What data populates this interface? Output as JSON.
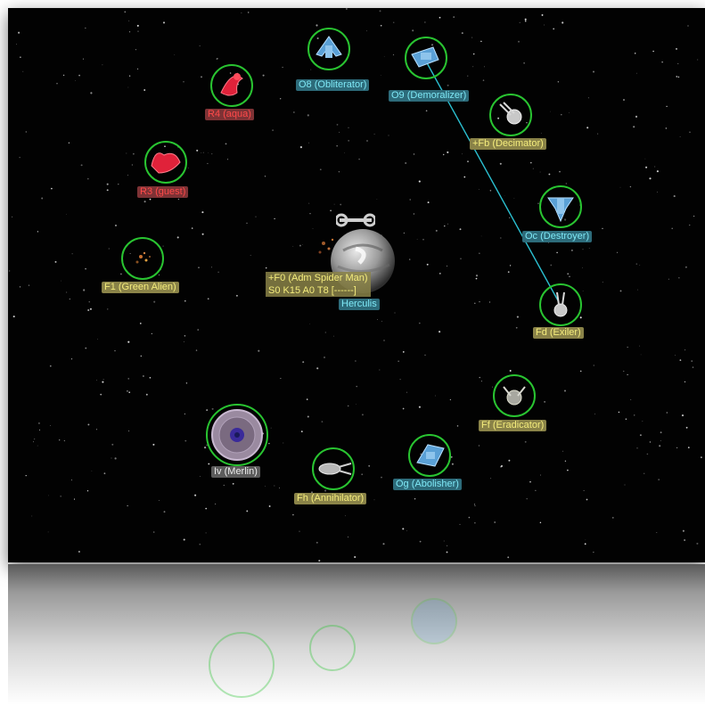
{
  "colors": {
    "ship_ring": "#29c431",
    "tractor_beam": "#2bbfd0",
    "label_yellow_text": "#f4ec7c",
    "label_cyan_text": "#7ee8f6",
    "label_red_text": "#ff4a4a"
  },
  "ships": [
    {
      "id": "O8",
      "label": "O8 (Obliterator)",
      "team": "cyan",
      "icon": "romulan-warbird-icon"
    },
    {
      "id": "O9",
      "label": "O9 (Demoralizer)",
      "team": "cyan",
      "icon": "romulan-warbird-icon"
    },
    {
      "id": "R4",
      "label": "R4 (aqua)",
      "team": "red",
      "icon": "klingon-cruiser-icon"
    },
    {
      "id": "R3",
      "label": "R3 (guest)",
      "team": "red",
      "icon": "klingon-cruiser-icon"
    },
    {
      "id": "Fb",
      "label": "+Fb (Decimator)",
      "team": "yellow",
      "icon": "federation-starship-icon"
    },
    {
      "id": "Oc",
      "label": "Oc (Destroyer)",
      "team": "cyan",
      "icon": "romulan-warbird-icon"
    },
    {
      "id": "F1",
      "label": "F1 (Green Alien)",
      "team": "yellow",
      "icon": "explosion-debris-icon"
    },
    {
      "id": "Fd",
      "label": "Fd (Exiler)",
      "team": "yellow",
      "icon": "federation-starship-icon"
    },
    {
      "id": "Ff",
      "label": "Ff (Eradicator)",
      "team": "yellow",
      "icon": "federation-starship-icon"
    },
    {
      "id": "Iv",
      "label": "Iv (Merlin)",
      "team": "white",
      "icon": "independent-starbase-icon"
    },
    {
      "id": "Og",
      "label": "Og (Abolisher)",
      "team": "cyan",
      "icon": "romulan-warbird-icon"
    },
    {
      "id": "Fh",
      "label": "Fh (Annihilator)",
      "team": "yellow",
      "icon": "federation-cruiser-icon"
    }
  ],
  "planet": {
    "name": "Herculis",
    "owner_line": "+F0 (Adm Spider Man)",
    "stats_line": "S0 K15 A0 T8 [------]",
    "icon": "planet-icon",
    "repair_icon": "wrench-icon"
  }
}
